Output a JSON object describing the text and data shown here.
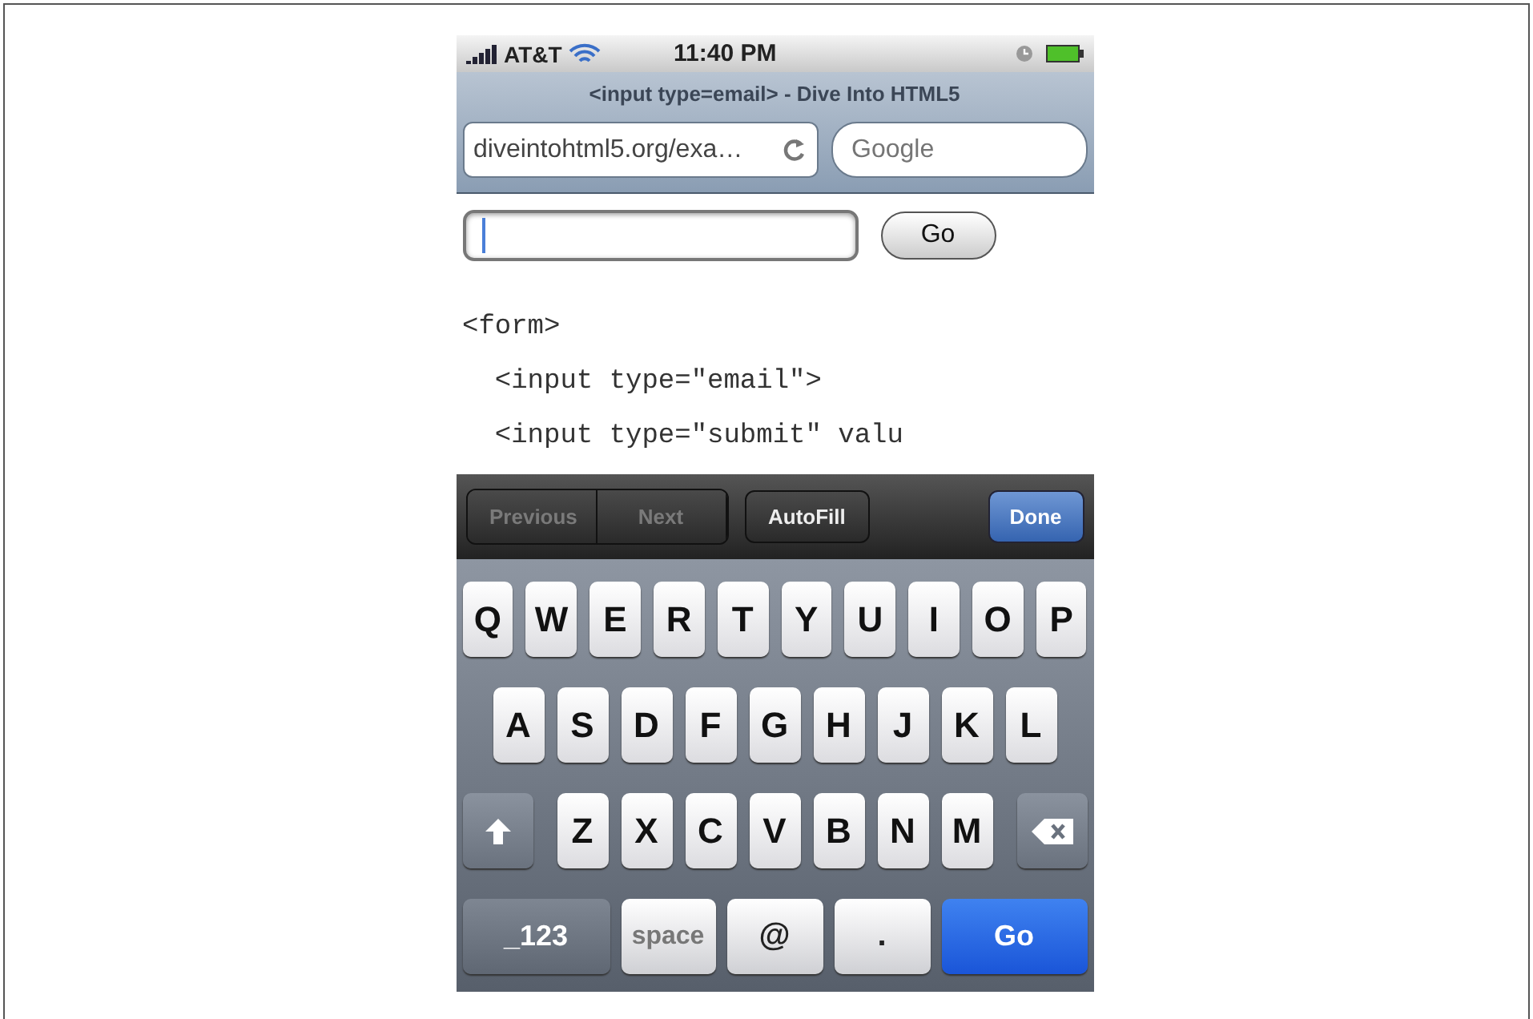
{
  "status_bar": {
    "carrier": "AT&T",
    "time": "11:40 PM"
  },
  "browser": {
    "title": "<input type=email> - Dive Into HTML5",
    "url": "diveintohtml5.org/exa…",
    "search_placeholder": "Google"
  },
  "page": {
    "email_field": {
      "focused": true
    },
    "go_button": "Go",
    "code_lines": [
      "<form>",
      "  <input type=\"email\">",
      "  <input type=\"submit\" valu"
    ]
  },
  "form_toolbar": {
    "buttons": [
      {
        "label": "Previous",
        "disabled": true
      },
      {
        "label": "Next",
        "disabled": true
      },
      {
        "label": "AutoFill",
        "disabled": false
      }
    ],
    "done": "Done"
  },
  "keyboard": {
    "rows": [
      [
        "Q",
        "W",
        "E",
        "R",
        "T",
        "Y",
        "U",
        "I",
        "O",
        "P"
      ],
      [
        "A",
        "S",
        "D",
        "F",
        "G",
        "H",
        "J",
        "K",
        "L"
      ],
      [
        "Z",
        "X",
        "C",
        "V",
        "B",
        "N",
        "M"
      ]
    ],
    "bottom": [
      {
        "label": "_123",
        "kind": "mode"
      },
      {
        "label": "space",
        "kind": "space"
      },
      {
        "label": "@",
        "kind": "char"
      },
      {
        "label": ".",
        "kind": "char"
      },
      {
        "label": "Go",
        "kind": "action"
      }
    ]
  }
}
